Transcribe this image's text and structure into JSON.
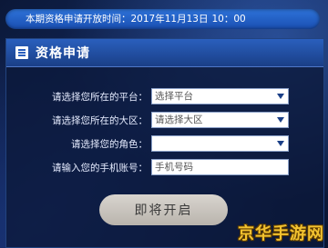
{
  "notice": {
    "label": "本期资格申请开放时间：",
    "date": "2017年11月13日",
    "time": "10：00"
  },
  "panel": {
    "title": "资格申请",
    "form": {
      "platform": {
        "label": "请选择您所在的平台：",
        "placeholder": "选择平台"
      },
      "region": {
        "label": "请选择您所在的大区：",
        "placeholder": "请选择大区"
      },
      "role": {
        "label": "请选择您的角色：",
        "placeholder": ""
      },
      "phone": {
        "label": "请输入您的手机账号：",
        "placeholder": "手机号码"
      }
    },
    "submit_label": "即将开启"
  },
  "watermark": "京华手游网",
  "colors": {
    "notice_bar": "#1f5cc4",
    "panel_header": "#2a5fbd",
    "button": "#c9c4bd",
    "watermark": "#f2c230"
  },
  "icons": {
    "panel_header": "document-icon",
    "select": "caret-down-icon"
  }
}
